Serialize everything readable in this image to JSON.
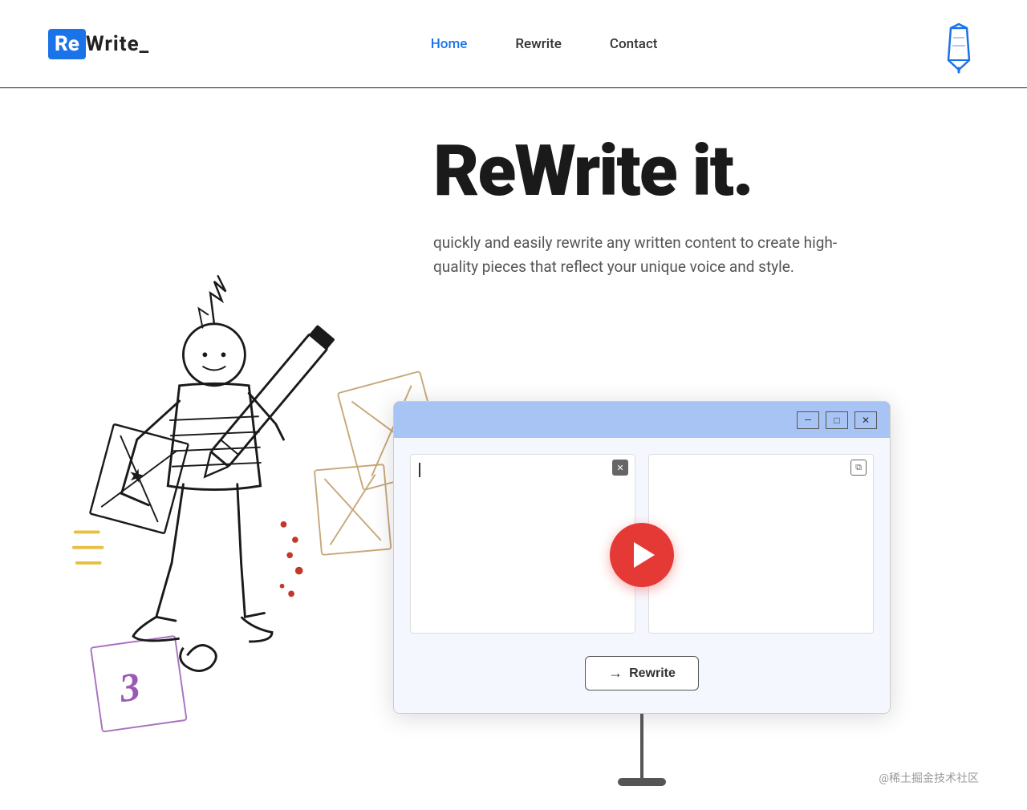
{
  "header": {
    "logo_re": "Re",
    "logo_write": "Write_",
    "nav": {
      "home": "Home",
      "rewrite": "Rewrite",
      "contact": "Contact"
    }
  },
  "hero": {
    "title": "ReWrite it.",
    "subtitle": "quickly and easily rewrite any written content to create high-quality pieces that reflect your unique voice and style."
  },
  "app_window": {
    "minimize_label": "—",
    "maximize_label": "□",
    "close_label": "✕",
    "rewrite_button": "Rewrite"
  },
  "footer": {
    "watermark": "@稀土掘金技术社区"
  },
  "colors": {
    "brand_blue": "#1a73e8",
    "brand_red": "#e53935",
    "titlebar_blue": "#a8c4f5",
    "text_dark": "#1a1a1a",
    "text_mid": "#555"
  }
}
